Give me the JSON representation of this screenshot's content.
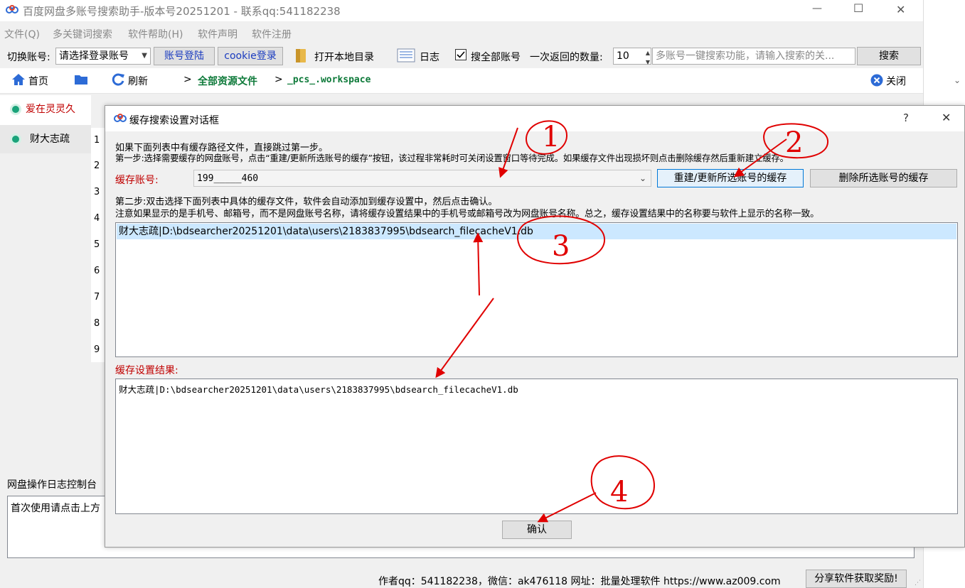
{
  "window": {
    "title": "百度网盘多账号搜索助手-版本号20251201 - 联系qq:541182238",
    "minimize_glyph": "—",
    "maximize_glyph": "☐",
    "close_glyph": "✕"
  },
  "menu": [
    "文件(Q)",
    "多关键词搜索",
    "软件帮助(H)",
    "软件声明",
    "软件注册"
  ],
  "toolbar": {
    "switch_account_label": "切换账号:",
    "account_select_value": "请选择登录账号",
    "account_login_btn": "账号登陆",
    "cookie_login_btn": "cookie登录",
    "open_local_dir": "打开本地目录",
    "log": "日志",
    "search_all_label": "搜全部账号",
    "search_all_checked": true,
    "return_count_label": "一次返回的数量:",
    "return_count_value": "10",
    "search_placeholder": "多账号一键搜索功能，请输入搜索的关...",
    "search_btn": "搜索"
  },
  "nav": {
    "home": "首页",
    "refresh": "刷新",
    "path_sep": ">",
    "path_root": "全部资源文件",
    "path_item": "_pcs_.workspace",
    "close": "关闭"
  },
  "sidebar": {
    "accounts": [
      {
        "name": "爱在灵灵久",
        "active": true
      },
      {
        "name": "财大志疏",
        "active": false
      }
    ]
  },
  "row_numbers": [
    "1",
    "2",
    "3",
    "4",
    "5",
    "6",
    "7",
    "8",
    "9"
  ],
  "log_panel": {
    "title": "网盘操作日志控制台",
    "text": "首次使用请点击上方"
  },
  "status": {
    "author": "作者qq：541182238，微信：ak476118  网址：批量处理软件 https://www.az009.com",
    "share_btn": "分享软件获取奖励!"
  },
  "dialog": {
    "title": "缓存搜索设置对话框",
    "help": "?",
    "close": "✕",
    "intro_line1": "如果下面列表中有缓存路径文件，直接跳过第一步。",
    "intro_line2": "第一步:选择需要缓存的网盘账号，点击“重建/更新所选账号的缓存”按钮，该过程非常耗时可关闭设置窗口等待完成。如果缓存文件出现损坏则点击删除缓存然后重新建立缓存。",
    "cache_account_label": "缓存账号:",
    "cache_account_value": "199_____460",
    "rebuild_btn": "重建/更新所选账号的缓存",
    "delete_btn": "删除所选账号的缓存",
    "step2_line1": "第二步:双击选择下面列表中具体的缓存文件，软件会自动添加到缓存设置中，然后点击确认。",
    "step2_line2": "注意如果显示的是手机号、邮箱号，而不是网盘账号名称，请将缓存设置结果中的手机号或邮箱号改为网盘账号名称。总之，缓存设置结果中的名称要与软件上显示的名称一致。",
    "cache_files": [
      "财大志疏|D:\\bdsearcher20251201\\data\\users\\2183837995\\bdsearch_filecacheV1.db"
    ],
    "result_label": "缓存设置结果:",
    "result_text": "财大志疏|D:\\bdsearcher20251201\\data\\users\\2183837995\\bdsearch_filecacheV1.db",
    "confirm_btn": "确认"
  },
  "annotations": {
    "labels": [
      "1",
      "2",
      "3",
      "4"
    ],
    "color": "#e00000"
  }
}
